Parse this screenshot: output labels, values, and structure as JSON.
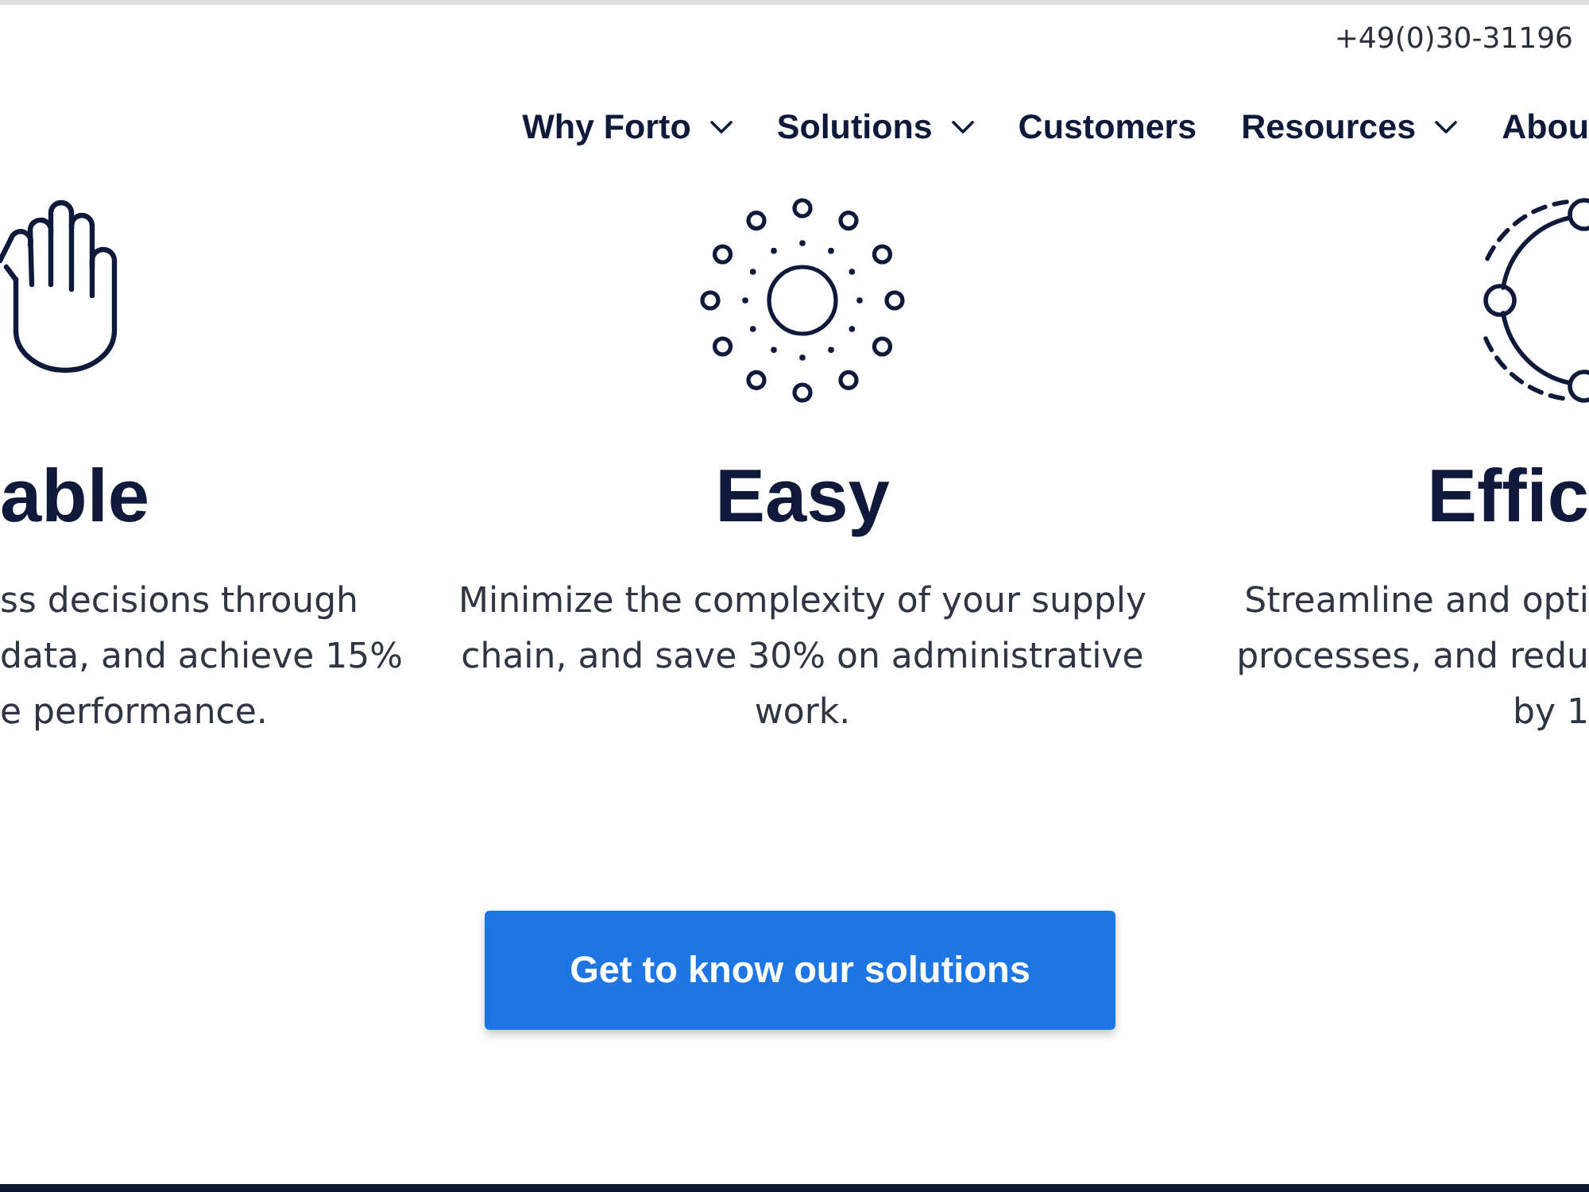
{
  "header": {
    "phone": "+49(0)30-31196",
    "nav": [
      {
        "label": "Why Forto",
        "has_dropdown": true
      },
      {
        "label": "Solutions",
        "has_dropdown": true
      },
      {
        "label": "Customers",
        "has_dropdown": false
      },
      {
        "label": "Resources",
        "has_dropdown": true
      },
      {
        "label": "Abou",
        "has_dropdown": false
      }
    ]
  },
  "features": [
    {
      "title": "able",
      "lines": [
        "ss decisions through",
        "data, and achieve 15%",
        "e performance."
      ]
    },
    {
      "title": "Easy",
      "lines": [
        "Minimize the complexity of your supply chain, and save 30% on administrative work."
      ]
    },
    {
      "title": "Effic",
      "lines": [
        "Streamline and opti",
        "processes, and redu",
        "by 1"
      ]
    }
  ],
  "cta": {
    "label": "Get to know our solutions"
  }
}
